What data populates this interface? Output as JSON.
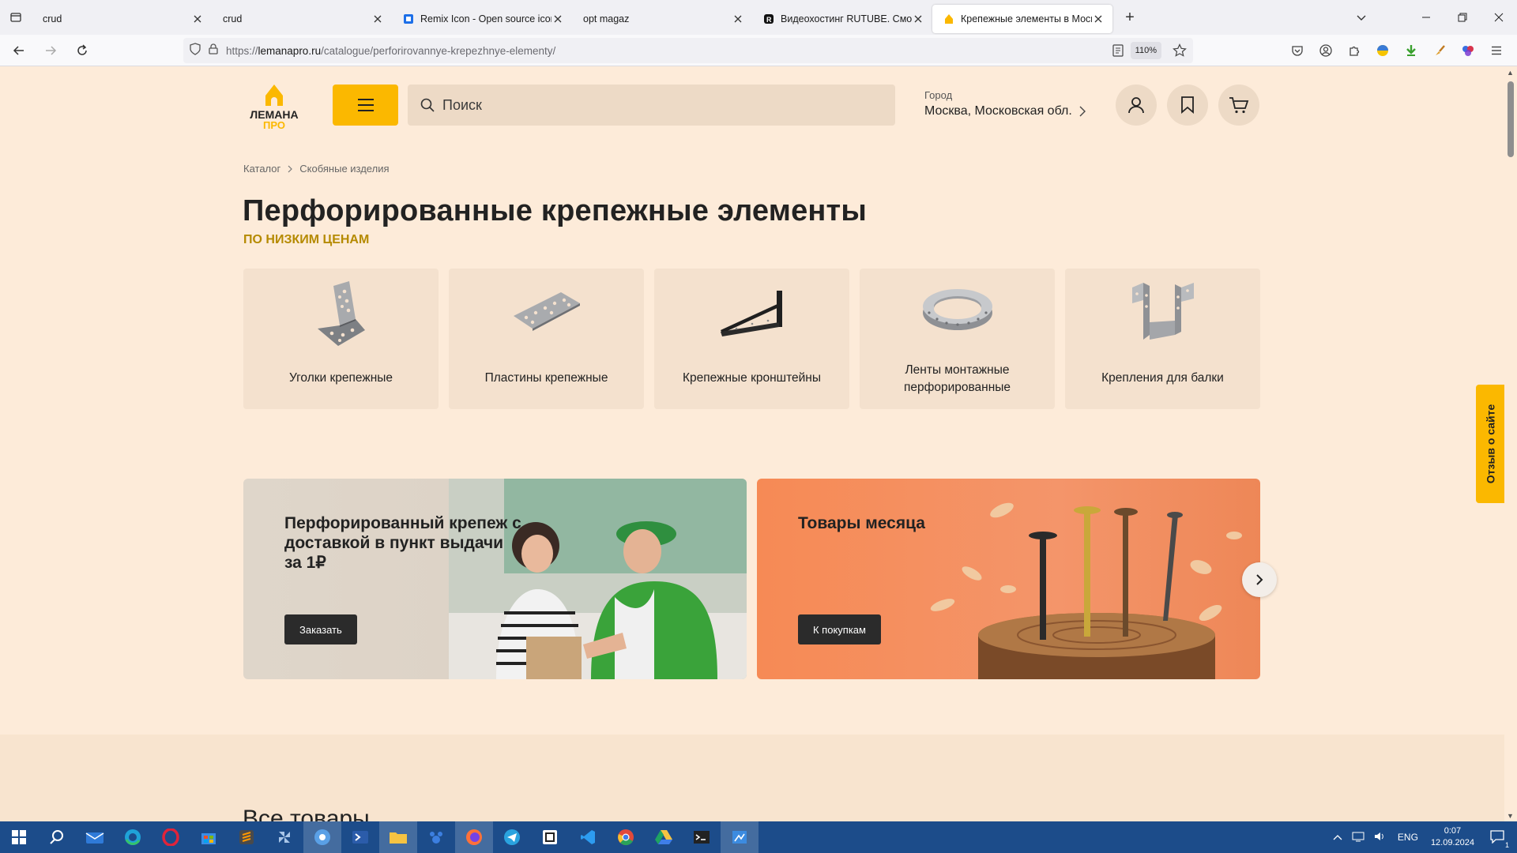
{
  "browser": {
    "tabs": [
      {
        "title": "crud",
        "icon": "none",
        "active": false
      },
      {
        "title": "crud",
        "icon": "none",
        "active": false
      },
      {
        "title": "Remix Icon - Open source icon",
        "icon": "remix-icon",
        "active": false
      },
      {
        "title": "opt magaz",
        "icon": "none",
        "active": false
      },
      {
        "title": "Видеохостинг RUTUBE. Смотр",
        "icon": "rutube-icon",
        "active": false
      },
      {
        "title": "Крепежные элементы в Моск",
        "icon": "lemana-icon",
        "active": true
      }
    ],
    "url_domain": "lemanapro.ru",
    "url_prefix": "https://",
    "url_path": "/catalogue/perforirovannye-krepezhnye-elementy/",
    "zoom": "110%"
  },
  "site": {
    "logo_text_1": "ЛЕМАНА",
    "logo_text_2": "ПРО",
    "search_placeholder": "Поиск",
    "city_label": "Город",
    "city_value": "Москва, Московская обл.",
    "brand_color": "#fbb800"
  },
  "breadcrumb": [
    "Каталог",
    "Скобяные изделия"
  ],
  "page_title": "Перфорированные крепежные элементы",
  "page_subtitle": "ПО НИЗКИМ ЦЕНАМ",
  "categories": [
    {
      "label": "Уголки крепежные",
      "icon": "angle-bracket-icon"
    },
    {
      "label": "Пластины крепежные",
      "icon": "mounting-plate-icon"
    },
    {
      "label": "Крепежные кронштейны",
      "icon": "wall-bracket-icon"
    },
    {
      "label": "Ленты монтажные перфорированные",
      "icon": "perforated-tape-icon"
    },
    {
      "label": "Крепления для балки",
      "icon": "beam-hanger-icon"
    }
  ],
  "banners": [
    {
      "title": "Перфорированный крепеж с доставкой в пункт выдачи за 1₽",
      "button": "Заказать"
    },
    {
      "title": "Товары месяца",
      "button": "К покупкам"
    }
  ],
  "feedback_label": "Отзыв о сайте",
  "section_title": "Все товары",
  "taskbar": {
    "lang": "ENG",
    "time": "0:07",
    "date": "12.09.2024",
    "notifications": "1"
  }
}
